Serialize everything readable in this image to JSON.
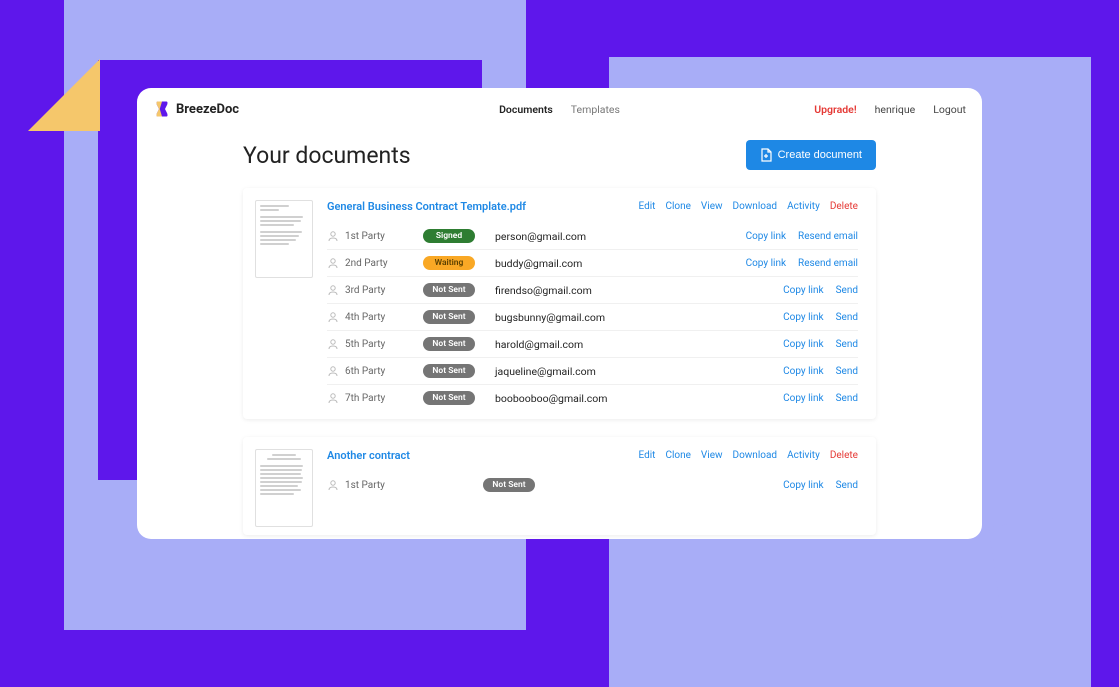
{
  "brand": "BreezeDoc",
  "nav": {
    "documents": "Documents",
    "templates": "Templates"
  },
  "header": {
    "upgrade": "Upgrade!",
    "user": "henrique",
    "logout": "Logout"
  },
  "page_title": "Your documents",
  "create_label": "Create document",
  "doc_actions": {
    "edit": "Edit",
    "clone": "Clone",
    "view": "View",
    "download": "Download",
    "activity": "Activity",
    "delete": "Delete"
  },
  "party_actions": {
    "copy_link": "Copy link",
    "resend": "Resend email",
    "send": "Send"
  },
  "status": {
    "signed": "Signed",
    "waiting": "Waiting",
    "not_sent": "Not Sent"
  },
  "doc1": {
    "title": "General Business Contract Template.pdf",
    "p1_label": "1st Party",
    "p1_email": "person@gmail.com",
    "p2_label": "2nd Party",
    "p2_email": "buddy@gmail.com",
    "p3_label": "3rd Party",
    "p3_email": "firendso@gmail.com",
    "p4_label": "4th Party",
    "p4_email": "bugsbunny@gmail.com",
    "p5_label": "5th Party",
    "p5_email": "harold@gmail.com",
    "p6_label": "6th Party",
    "p6_email": "jaqueline@gmail.com",
    "p7_label": "7th Party",
    "p7_email": "boobooboo@gmail.com"
  },
  "doc2": {
    "title": "Another contract",
    "p1_label": "1st Party"
  }
}
